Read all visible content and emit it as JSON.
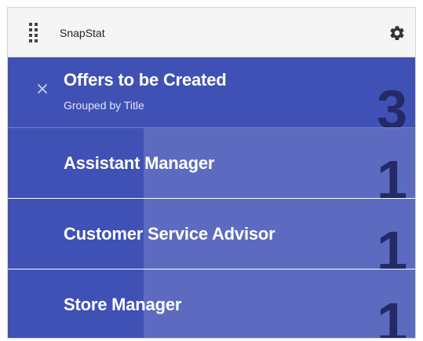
{
  "header": {
    "app_title": "SnapStat"
  },
  "summary": {
    "title": "Offers to be Created",
    "subtitle": "Grouped by Title",
    "count": "3"
  },
  "groups": [
    {
      "label": "Assistant Manager",
      "count": "1",
      "fraction": 0.333
    },
    {
      "label": "Customer Service Advisor",
      "count": "1",
      "fraction": 0.333
    },
    {
      "label": "Store Manager",
      "count": "1",
      "fraction": 0.333
    }
  ],
  "colors": {
    "summary_bg": "#3f51b5",
    "group_bg": "#5c6bc0",
    "group_fill": "#3f51b5",
    "count_text": "#232a66"
  },
  "icons": {
    "drag": "drag-handle-icon",
    "settings": "gear-icon",
    "close": "close-icon"
  }
}
